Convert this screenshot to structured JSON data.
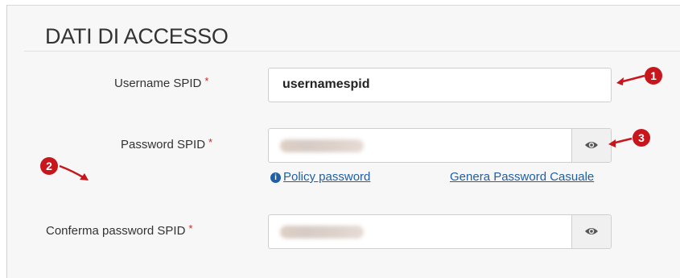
{
  "section": {
    "title": "DATI DI ACCESSO"
  },
  "username": {
    "label": "Username SPID",
    "required_mark": "*",
    "value": "usernamespid"
  },
  "password": {
    "label": "Password SPID",
    "required_mark": "*",
    "toggle_icon": "eye-icon",
    "policy_icon": "info-icon",
    "policy_link": "Policy password",
    "generate_link": "Genera Password Casuale"
  },
  "confirm": {
    "label": "Conferma password SPID",
    "required_mark": "*",
    "toggle_icon": "eye-icon"
  },
  "annotations": {
    "badge_1": "1",
    "badge_2": "2",
    "badge_3": "3",
    "color": "#c8161d"
  },
  "colors": {
    "link": "#1f5fa6",
    "required": "#d9251c"
  }
}
